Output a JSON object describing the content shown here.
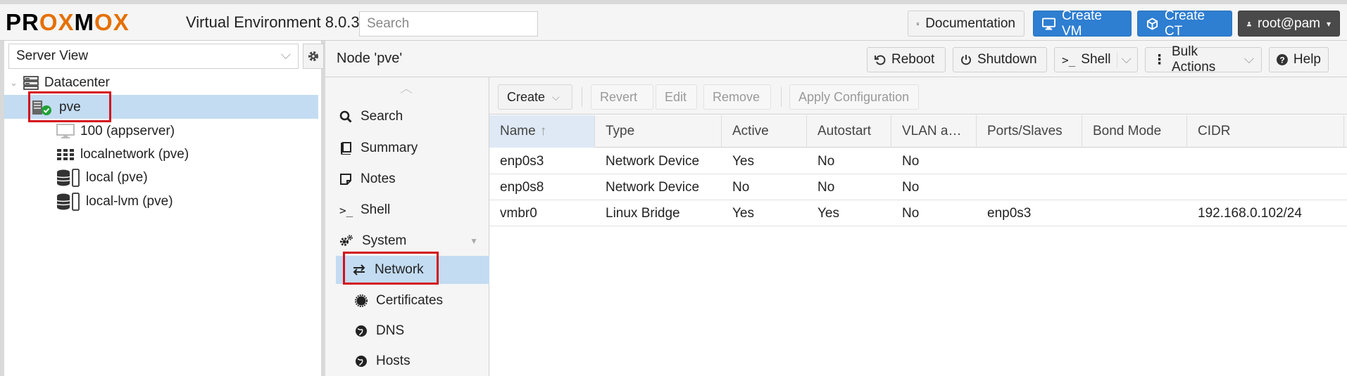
{
  "topbar": {
    "logo_text": "PROXMOX",
    "title": "Virtual Environment 8.0.3",
    "search_placeholder": "Search",
    "documentation_label": "Documentation",
    "create_vm_label": "Create VM",
    "create_ct_label": "Create CT",
    "user_label": "root@pam"
  },
  "sidebar": {
    "view_label": "Server View",
    "tree": [
      {
        "label": "Datacenter",
        "icon": "server-rack-icon"
      },
      {
        "label": "pve",
        "icon": "node-online-icon"
      },
      {
        "label": "100 (appserver)",
        "icon": "monitor-icon"
      },
      {
        "label": "localnetwork (pve)",
        "icon": "grid-icon"
      },
      {
        "label": "local (pve)",
        "icon": "storage-icon"
      },
      {
        "label": "local-lvm (pve)",
        "icon": "storage-icon"
      }
    ]
  },
  "node_header": {
    "title": "Node 'pve'",
    "reboot_label": "Reboot",
    "shutdown_label": "Shutdown",
    "shell_label": "Shell",
    "bulk_label": "Bulk Actions",
    "help_label": "Help"
  },
  "nav": {
    "items": [
      {
        "label": "Search",
        "icon": "search-icon"
      },
      {
        "label": "Summary",
        "icon": "book-icon"
      },
      {
        "label": "Notes",
        "icon": "notes-icon"
      },
      {
        "label": "Shell",
        "icon": "terminal-icon"
      },
      {
        "label": "System",
        "icon": "cogs-icon"
      },
      {
        "label": "Network",
        "icon": "exchange-icon"
      },
      {
        "label": "Certificates",
        "icon": "certificate-icon"
      },
      {
        "label": "DNS",
        "icon": "globe-icon"
      },
      {
        "label": "Hosts",
        "icon": "globe-icon"
      }
    ]
  },
  "network": {
    "toolbar": {
      "create": "Create",
      "revert": "Revert",
      "edit": "Edit",
      "remove": "Remove",
      "apply": "Apply Configuration"
    },
    "columns": [
      "Name",
      "Type",
      "Active",
      "Autostart",
      "VLAN a…",
      "Ports/Slaves",
      "Bond Mode",
      "CIDR"
    ],
    "rows": [
      [
        "enp0s3",
        "Network Device",
        "Yes",
        "No",
        "No",
        "",
        "",
        ""
      ],
      [
        "enp0s8",
        "Network Device",
        "No",
        "No",
        "No",
        "",
        "",
        ""
      ],
      [
        "vmbr0",
        "Linux Bridge",
        "Yes",
        "Yes",
        "No",
        "enp0s3",
        "",
        "192.168.0.102/24"
      ]
    ]
  },
  "colors": {
    "accent_orange": "#e57000",
    "primary_blue": "#2e7ed1",
    "selection_blue": "#c3dcf2",
    "highlight_red": "#d4101b"
  }
}
